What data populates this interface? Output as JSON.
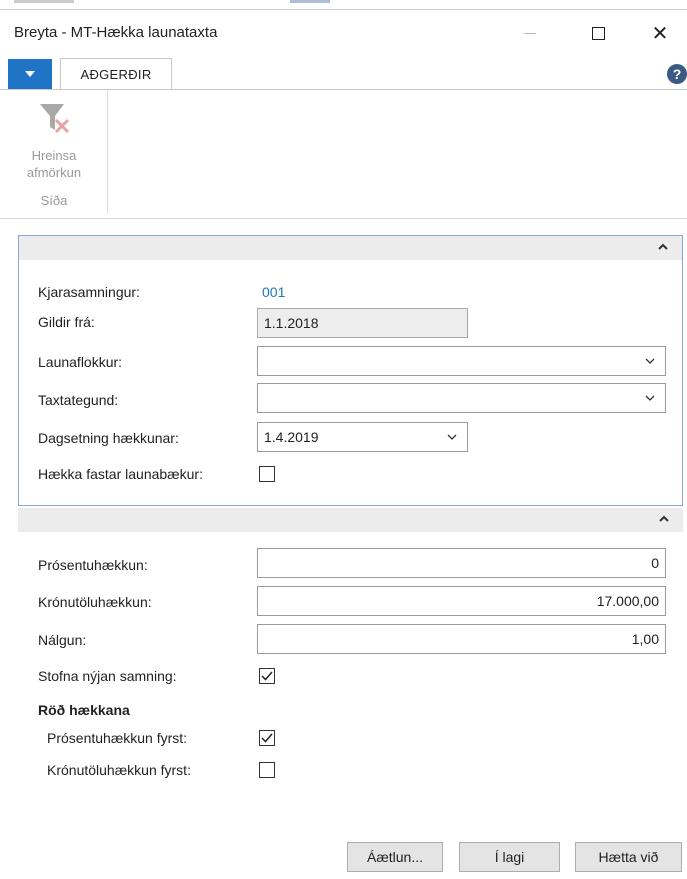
{
  "window": {
    "title": "Breyta - MT-Hækka launataxta",
    "minimize_icon": "minimize-icon",
    "maximize_icon": "maximize-icon",
    "close_icon": "close-icon",
    "close_glyph": "✕"
  },
  "tabs": {
    "actions_label": "AÐGERÐIR",
    "help_glyph": "?"
  },
  "ribbon": {
    "clear_filter_label_line1": "Hreinsa",
    "clear_filter_label_line2": "afmörkun",
    "group_name": "Síða",
    "icon": "clear-filter-icon"
  },
  "general": {
    "agreement_label": "Kjarasamningur:",
    "agreement_value": "001",
    "valid_from_label": "Gildir frá:",
    "valid_from_value": "1.1.2018",
    "wage_group_label": "Launaflokkur:",
    "wage_group_value": "",
    "rate_type_label": "Taxtategund:",
    "rate_type_value": "",
    "raise_date_label": "Dagsetning hækkunar:",
    "raise_date_value": "1.4.2019",
    "raise_fixed_label": "Hækka fastar launabækur:",
    "raise_fixed_checked": false
  },
  "options": {
    "percent_label": "Prósentuhækkun:",
    "percent_value": "0",
    "amount_label": "Krónutöluhækkun:",
    "amount_value": "17.000,00",
    "rounding_label": "Nálgun:",
    "rounding_value": "1,00",
    "new_agreement_label": "Stofna nýjan samning:",
    "new_agreement_checked": true,
    "order_heading": "Röð hækkana",
    "percent_first_label": "Prósentuhækkun fyrst:",
    "percent_first_checked": true,
    "amount_first_label": "Krónutöluhækkun fyrst:",
    "amount_first_checked": false
  },
  "buttons": {
    "plan_label": "Áætlun...",
    "ok_label": "Í lagi",
    "cancel_label": "Hætta við"
  },
  "colors": {
    "accent": "#1f74c6",
    "panel_border": "#86a9d9",
    "section_band": "#ececec"
  }
}
